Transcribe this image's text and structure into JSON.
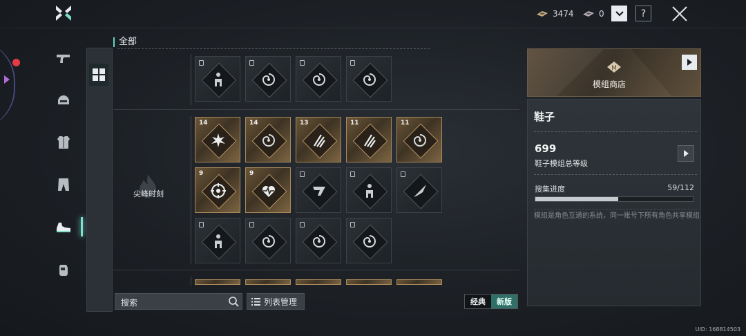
{
  "top": {
    "currency1_value": "3474",
    "currency2_value": "0",
    "dropdown_glyph": "⌄",
    "help_glyph": "?"
  },
  "category_icons": [
    "pistol-icon",
    "helmet-icon",
    "armor-icon",
    "pants-icon",
    "shoes-icon",
    "glove-icon"
  ],
  "active_category": "shoes-icon",
  "section_title": "全部",
  "group_label": "尖峰时刻",
  "rows": {
    "row0": [
      {
        "level": "",
        "gold": false,
        "icon": "figure-icon"
      },
      {
        "level": "",
        "gold": false,
        "icon": "swirl-icon"
      },
      {
        "level": "",
        "gold": false,
        "icon": "swirl-icon"
      },
      {
        "level": "",
        "gold": false,
        "icon": "swirl-icon"
      }
    ],
    "row1": [
      {
        "level": "14",
        "gold": true,
        "icon": "burst-icon"
      },
      {
        "level": "14",
        "gold": true,
        "icon": "swirl-icon"
      },
      {
        "level": "13",
        "gold": true,
        "icon": "claw-icon"
      },
      {
        "level": "11",
        "gold": true,
        "icon": "claw-icon"
      },
      {
        "level": "11",
        "gold": true,
        "icon": "swirl-icon"
      }
    ],
    "row2": [
      {
        "level": "9",
        "gold": true,
        "icon": "target-icon"
      },
      {
        "level": "9",
        "gold": true,
        "icon": "heart-icon"
      },
      {
        "level": "",
        "gold": false,
        "icon": "blade-icon"
      },
      {
        "level": "",
        "gold": false,
        "icon": "figure-icon"
      },
      {
        "level": "",
        "gold": false,
        "icon": "knife-icon"
      }
    ],
    "row3": [
      {
        "level": "",
        "gold": false,
        "icon": "figure-icon"
      },
      {
        "level": "",
        "gold": false,
        "icon": "swirl-icon"
      },
      {
        "level": "",
        "gold": false,
        "icon": "swirl-icon"
      },
      {
        "level": "",
        "gold": false,
        "icon": "swirl-icon"
      }
    ]
  },
  "search": {
    "label": "搜索"
  },
  "list_manage_label": "列表管理",
  "toggle": {
    "classic": "经典",
    "new": "新版",
    "selected": "新版"
  },
  "shop_label": "模组商店",
  "info": {
    "title": "鞋子",
    "level_value": "699",
    "level_label": "鞋子模组总等级",
    "collect_label": "搜集进度",
    "collect_value": "59/112",
    "collect_fraction": 0.527,
    "description": "模组是角色互通的系统，同一账号下所有角色共享模组"
  },
  "uid": "UID: 168814503",
  "colors": {
    "accent_teal": "#62d7bf",
    "gold": "#a88a5c",
    "alert_red": "#e53b44"
  }
}
